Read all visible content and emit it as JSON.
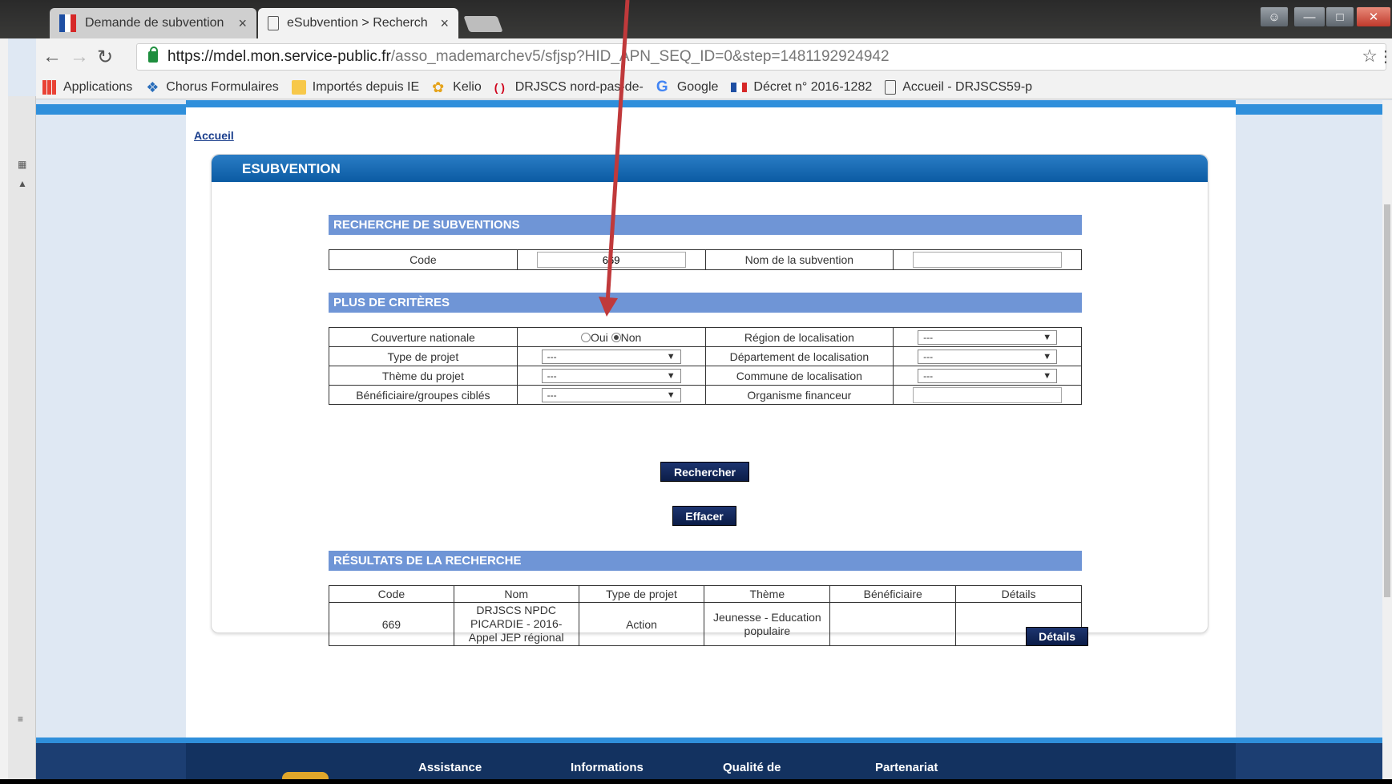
{
  "browser": {
    "tabs": [
      {
        "title": "Demande de subvention",
        "close": "×"
      },
      {
        "title": "eSubvention > Recherch",
        "close": "×"
      }
    ],
    "url": {
      "host": "https://mdel.mon.service-public.fr",
      "path": "/asso_mademarchev5/sfjsp?HID_APN_SEQ_ID=0&step=1481192924942"
    },
    "bookmarks": [
      "Applications",
      "Chorus Formulaires",
      "Importés depuis IE",
      "Kelio",
      "DRJSCS nord-pas-de-",
      "Google",
      "Décret n° 2016-1282",
      "Accueil - DRJSCS59-p"
    ],
    "colors": {
      "flag_blue": "#1f4fa3",
      "flag_white": "#ffffff",
      "flag_red": "#d62828"
    }
  },
  "page": {
    "breadcrumb": "Accueil",
    "panel_title": "ESUBVENTION",
    "search": {
      "title": "RECHERCHE DE SUBVENTIONS",
      "code_label": "Code",
      "code_value": "669",
      "name_label": "Nom de la subvention",
      "name_value": ""
    },
    "criteria": {
      "title": "PLUS DE CRITÈRES",
      "couverture_label": "Couverture nationale",
      "oui_label": "Oui",
      "non_label": "Non",
      "selected": "Non",
      "region_label": "Région de localisation",
      "type_label": "Type de projet",
      "departement_label": "Département de localisation",
      "theme_label": "Thème du projet",
      "commune_label": "Commune de localisation",
      "beneficiaire_label": "Bénéficiaire/groupes ciblés",
      "organisme_label": "Organisme financeur",
      "select_default": "---"
    },
    "buttons": {
      "search": "Rechercher",
      "clear": "Effacer"
    },
    "results": {
      "title": "RÉSULTATS DE LA RECHERCHE",
      "headers": [
        "Code",
        "Nom",
        "Type de projet",
        "Thème",
        "Bénéficiaire",
        "Détails"
      ],
      "rows": [
        {
          "code": "669",
          "nom": "DRJSCS NPDC PICARDIE - 2016- Appel JEP régional",
          "type": "Action",
          "theme": "Jeunesse - Education populaire",
          "beneficiaire": "",
          "details_button": "Détails"
        }
      ]
    },
    "footer": [
      "Assistance",
      "Informations",
      "Qualité de",
      "Partenariat"
    ]
  },
  "annotation": {
    "color": "#c0393b"
  }
}
